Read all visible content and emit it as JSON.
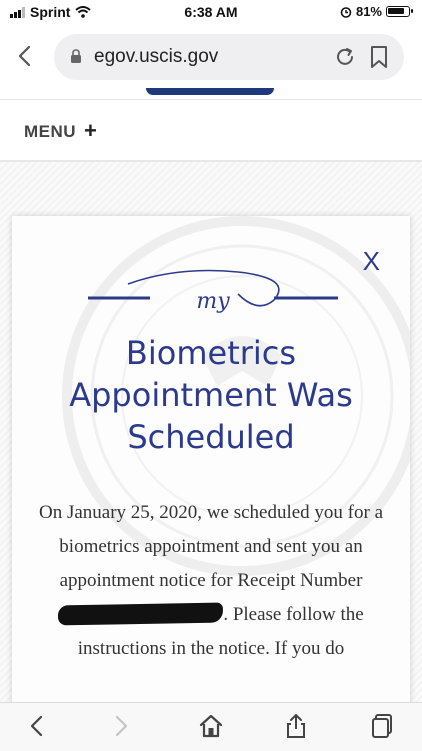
{
  "status": {
    "carrier": "Sprint",
    "time": "6:38 AM",
    "battery": "81%"
  },
  "browser": {
    "url": "egov.uscis.gov"
  },
  "header": {
    "menu_label": "MENU",
    "menu_plus": "+"
  },
  "modal": {
    "close": "X",
    "logo_text": "my",
    "title_lines": [
      "Biometrics",
      "Appointment Was",
      "Scheduled"
    ],
    "body_part1": "On January 25, 2020, we scheduled you for a biometrics appointment and sent you an appointment notice for Receipt Number",
    "body_part2": ". Please follow the instructions in the notice. If you do"
  },
  "colors": {
    "accent": "#2b3a8c",
    "nav_blue": "#1f3a7a"
  },
  "icons": [
    "wifi-icon",
    "alarm-icon",
    "battery-icon",
    "lock-icon",
    "reload-icon",
    "bookmark-icon",
    "back-icon",
    "forward-icon",
    "home-icon",
    "share-icon",
    "tabs-icon"
  ]
}
